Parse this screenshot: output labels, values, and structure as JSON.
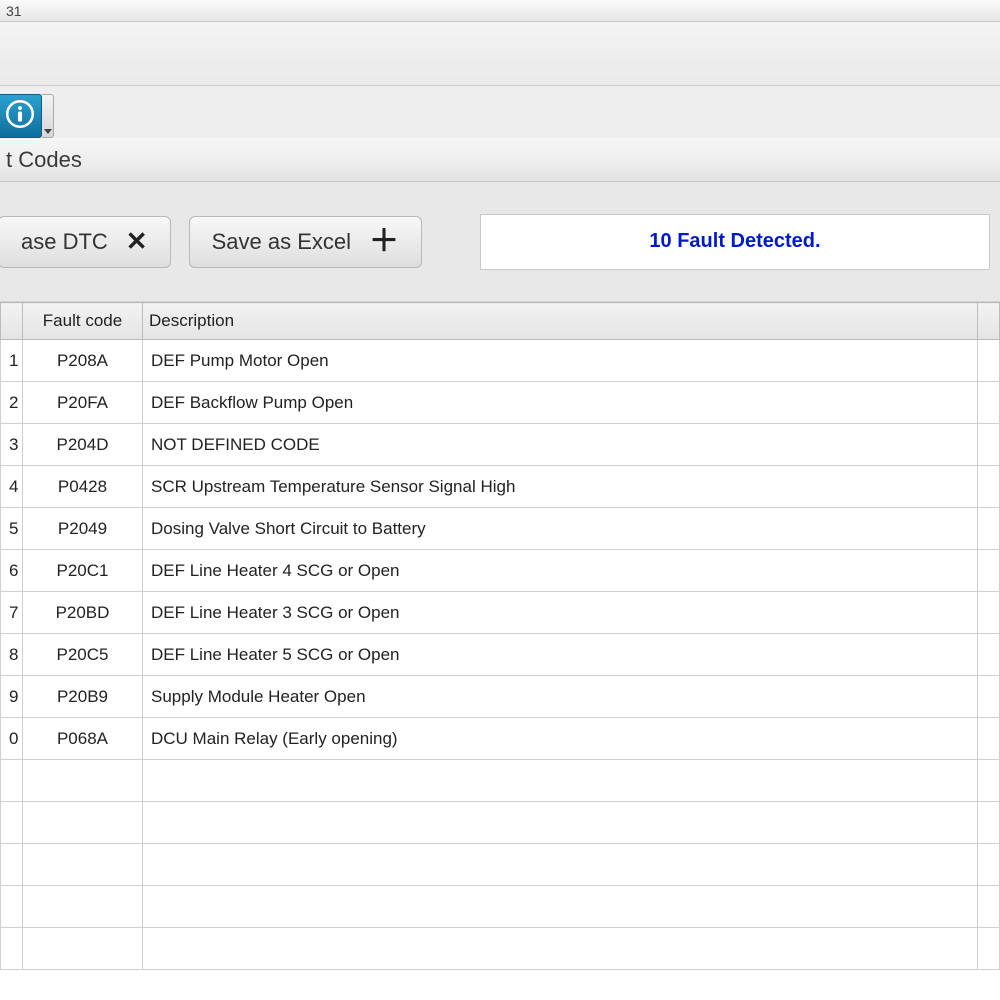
{
  "titlebar": {
    "text": "31"
  },
  "section": {
    "title": "t Codes"
  },
  "toolbar": {
    "erase_label": "ase DTC",
    "save_label": "Save as Excel"
  },
  "status": {
    "message": "10 Fault Detected."
  },
  "table": {
    "headers": {
      "num": "",
      "code": "Fault code",
      "desc": "Description",
      "extra": ""
    },
    "rows": [
      {
        "num": "1",
        "code": "P208A",
        "desc": "DEF Pump Motor Open"
      },
      {
        "num": "2",
        "code": "P20FA",
        "desc": "DEF Backflow Pump Open"
      },
      {
        "num": "3",
        "code": "P204D",
        "desc": "NOT DEFINED CODE"
      },
      {
        "num": "4",
        "code": "P0428",
        "desc": "SCR Upstream Temperature Sensor Signal High"
      },
      {
        "num": "5",
        "code": "P2049",
        "desc": "Dosing Valve Short Circuit to Battery"
      },
      {
        "num": "6",
        "code": "P20C1",
        "desc": "DEF Line Heater 4 SCG or Open"
      },
      {
        "num": "7",
        "code": "P20BD",
        "desc": "DEF Line Heater 3 SCG or Open"
      },
      {
        "num": "8",
        "code": "P20C5",
        "desc": "DEF Line Heater 5 SCG or Open"
      },
      {
        "num": "9",
        "code": "P20B9",
        "desc": "Supply Module Heater Open"
      },
      {
        "num": "0",
        "code": "P068A",
        "desc": "DCU Main Relay (Early opening)"
      }
    ],
    "empty_rows": 5
  }
}
